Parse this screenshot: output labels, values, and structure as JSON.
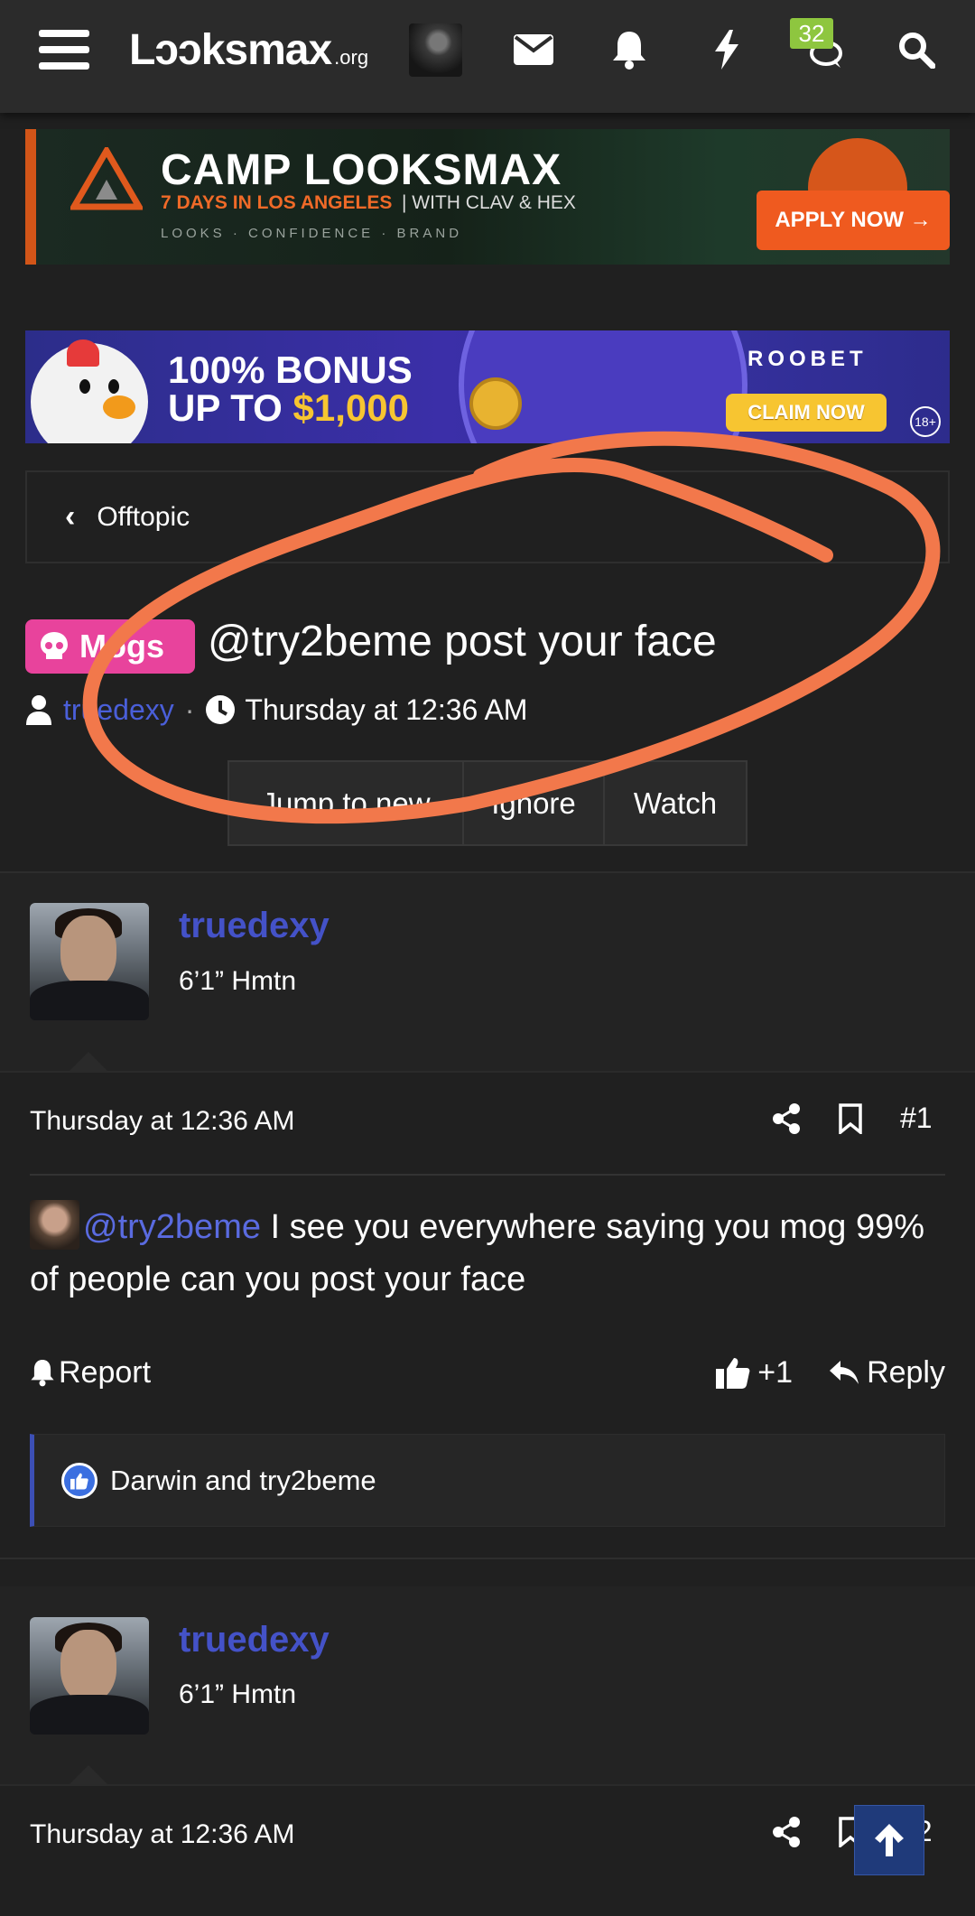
{
  "nav": {
    "logo_main": "Lɔɔksmax",
    "logo_suffix": ".org",
    "chat_badge": "32"
  },
  "banners": {
    "camp": {
      "title": "CAMP LOOKSMAX",
      "subtitle": "7 DAYS IN LOS ANGELES",
      "subtitle2": "| WITH CLAV & HEX",
      "tagline": "LOOKS · CONFIDENCE · BRAND",
      "cta": "APPLY NOW →"
    },
    "roobet": {
      "line1": "100% BONUS",
      "line2_prefix": "UP TO ",
      "line2_amount": "$1,000",
      "brand": "ROOBET",
      "cta": "CLAIM NOW",
      "age": "18+"
    }
  },
  "breadcrumb": {
    "label": "Offtopic"
  },
  "thread": {
    "prefix": "Mogs",
    "title": "@try2beme post your face",
    "author": "truedexy",
    "separator": "·",
    "date": "Thursday at 12:36 AM",
    "buttons": [
      "Jump to new",
      "Ignore",
      "Watch"
    ]
  },
  "posts": [
    {
      "username": "truedexy",
      "usertitle": "6’1” Hmtn",
      "date": "Thursday at 12:36 AM",
      "number": "#1",
      "mention": "@try2beme",
      "body": " I see you everywhere saying you mog 99% of people can you post your face",
      "report": "Report",
      "like_count": "+1",
      "reply": "Reply",
      "reactions": "Darwin and try2beme"
    },
    {
      "username": "truedexy",
      "usertitle": "6’1” Hmtn",
      "date": "Thursday at 12:36 AM",
      "number": "#2"
    }
  ],
  "colors": {
    "background": "#202020",
    "accent_blue": "#4452c8",
    "prefix_pink": "#e8439c",
    "annotation_orange": "#f2784b"
  }
}
